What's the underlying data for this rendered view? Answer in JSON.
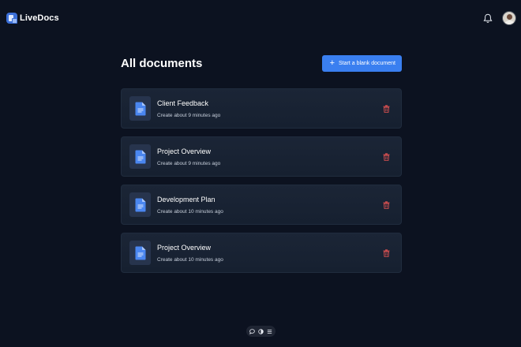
{
  "app": {
    "name": "LiveDocs"
  },
  "header": {
    "title": "All documents",
    "new_button_label": "Start a blank document"
  },
  "documents": [
    {
      "title": "Client Feedback",
      "meta": "Create about 9 minutes ago"
    },
    {
      "title": "Project Overview",
      "meta": "Create about 9 minutes ago"
    },
    {
      "title": "Development Plan",
      "meta": "Create about 10 minutes ago"
    },
    {
      "title": "Project Overview",
      "meta": "Create about 10 minutes ago"
    }
  ],
  "icons": {
    "logo": "livedocs-logo-icon",
    "notifications": "bell-icon",
    "user": "avatar",
    "document": "document-icon",
    "delete": "trash-icon",
    "toolbar": [
      "comment-icon",
      "theme-toggle-icon",
      "menu-icon"
    ]
  },
  "colors": {
    "background": "#0c1220",
    "card": "#1b2536",
    "accent": "#3a7ff0",
    "delete": "#e05252",
    "doc_icon": "#4a86f0"
  }
}
